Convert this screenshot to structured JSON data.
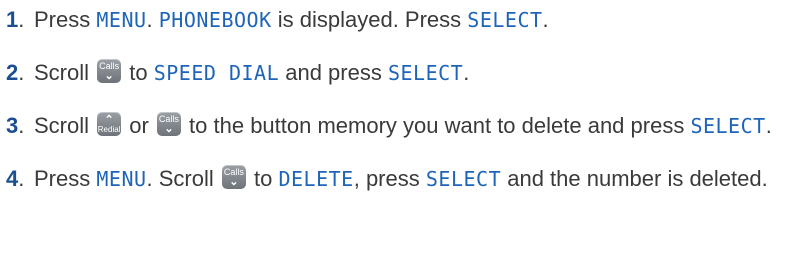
{
  "steps": [
    {
      "number": "1",
      "parts": {
        "t1": "Press ",
        "k1": "MENU",
        "t2": ". ",
        "k2": "PHONEBOOK",
        "t3": " is displayed. Press ",
        "k3": "SELECT",
        "t4": "."
      }
    },
    {
      "number": "2",
      "parts": {
        "t1": "Scroll ",
        "t2": " to ",
        "k1": "SPEED DIAL",
        "t3": " and press ",
        "k2": "SELECT",
        "t4": "."
      }
    },
    {
      "number": "3",
      "parts": {
        "t1": "Scroll ",
        "t2": " or ",
        "t3": " to the button memory you want to delete and press ",
        "k1": "SELECT",
        "t4": "."
      }
    },
    {
      "number": "4",
      "parts": {
        "t1": "Press ",
        "k1": "MENU",
        "t2": ". Scroll ",
        "t3": " to ",
        "k2": "DELETE",
        "t4": ", press ",
        "k3": "SELECT",
        "t5": " and the number is deleted."
      }
    }
  ],
  "keys": {
    "calls": {
      "label": "Calls",
      "glyph": "⌄",
      "icon": "calls-down-key-icon"
    },
    "redial": {
      "label": "Redial",
      "glyph": "⌃",
      "icon": "redial-up-key-icon"
    }
  },
  "colors": {
    "step_number": "#1b4f91",
    "keyword": "#1e64b8",
    "body_text": "#3a3a3a",
    "key_background": "#8a9096"
  }
}
